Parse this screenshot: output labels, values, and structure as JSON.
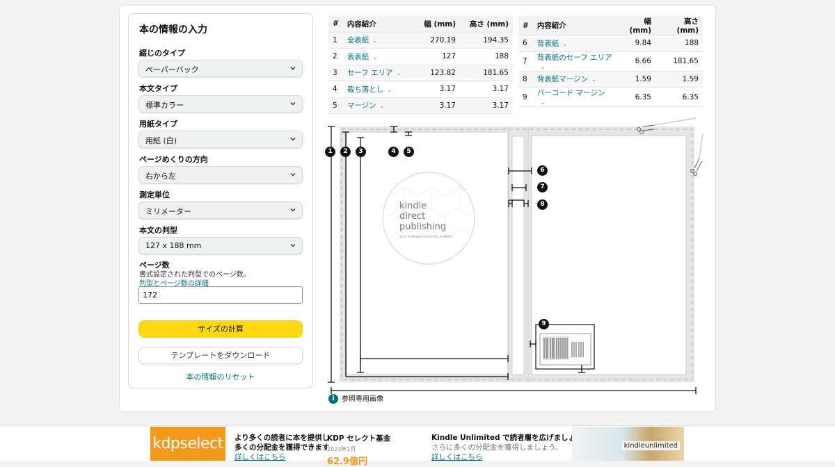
{
  "form": {
    "title": "本の情報の入力",
    "binding_label": "綴じのタイプ",
    "binding_value": "ペーパーバック",
    "interior_label": "本文タイプ",
    "interior_value": "標準カラー",
    "paper_label": "用紙タイプ",
    "paper_value": "用紙 (白)",
    "direction_label": "ページめくりの方向",
    "direction_value": "右から左",
    "unit_label": "測定単位",
    "unit_value": "ミリメーター",
    "trim_label": "本文の判型",
    "trim_value": "127 x 188 mm",
    "pages_label": "ページ数",
    "pages_help": "書式設定された判型でのページ数。",
    "pages_help_link": "判型とページ数の詳細",
    "pages_value": "172",
    "calc_button": "サイズの計算",
    "download_button": "テンプレートをダウンロード",
    "reset_link": "本の情報のリセット"
  },
  "table": {
    "headers": [
      "#",
      "内容紹介",
      "幅 (mm)",
      "高さ (mm)"
    ],
    "left_rows": [
      {
        "n": "1",
        "name": "全表紙",
        "w": "270.19",
        "h": "194.35"
      },
      {
        "n": "2",
        "name": "表表紙",
        "w": "127",
        "h": "188"
      },
      {
        "n": "3",
        "name": "セーフ エリア",
        "w": "123.82",
        "h": "181.65"
      },
      {
        "n": "4",
        "name": "裁ち落とし",
        "w": "3.17",
        "h": "3.17"
      },
      {
        "n": "5",
        "name": "マージン",
        "w": "3.17",
        "h": "3.17"
      }
    ],
    "right_rows": [
      {
        "n": "6",
        "name": "背表紙",
        "w": "9.84",
        "h": "188"
      },
      {
        "n": "7",
        "name": "背表紙のセーフ エリア",
        "w": "6.66",
        "h": "181.65"
      },
      {
        "n": "8",
        "name": "背表紙マージン",
        "w": "1.59",
        "h": "1.59"
      },
      {
        "n": "9",
        "name": "バーコード マージン",
        "w": "6.35",
        "h": "6.35"
      }
    ]
  },
  "diagram": {
    "markers": [
      "1",
      "2",
      "3",
      "4",
      "5",
      "6",
      "7",
      "8",
      "9"
    ],
    "kdp_logo_line1": "kindle",
    "kdp_logo_line2": "direct",
    "kdp_logo_line3": "publishing",
    "kdp_logo_tagline": "SELF-PUBLISH IN DIGITAL & PRINT",
    "note": "参照専用画像"
  },
  "promo": {
    "kdp_select_logo": "kdpselect",
    "line1": "より多くの読者に本を提供し",
    "line2": "多くの分配金を獲得できます",
    "link1": "詳しくはこちら",
    "fund_title": "KDP セレクト基金",
    "fund_date": "2023年1月",
    "fund_value": "62.9億円",
    "ku_title": "Kindle Unlimited で読者層を広げましょう。",
    "ku_sub": "さらに多くの分配金を獲得しましょう。",
    "link2": "詳しくはこちら",
    "ku_logo": "kindleunlimited"
  },
  "colors": {
    "accent_yellow": "#ffd814",
    "link_teal": "#007185",
    "kdp_orange": "#f39a1c"
  }
}
